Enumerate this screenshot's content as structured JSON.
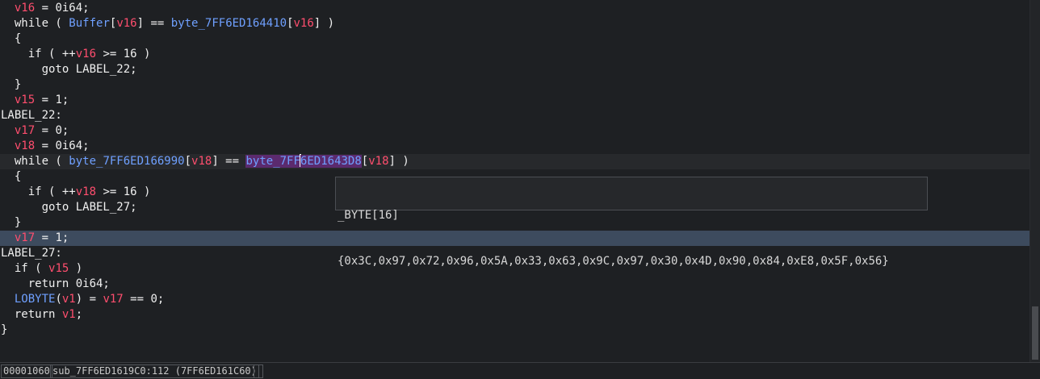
{
  "code": {
    "lines": [
      [
        [
          "  ",
          "pl"
        ],
        [
          "v16",
          "var"
        ],
        [
          " = 0i64;",
          "pl"
        ]
      ],
      [
        [
          "  while ( ",
          "kw"
        ],
        [
          "Buffer",
          "ident"
        ],
        [
          "[",
          "pl"
        ],
        [
          "v16",
          "var"
        ],
        [
          "] == ",
          "pl"
        ],
        [
          "byte_7FF6ED164410",
          "ident"
        ],
        [
          "[",
          "pl"
        ],
        [
          "v16",
          "var"
        ],
        [
          "] )",
          "pl"
        ]
      ],
      [
        [
          "  {",
          "pl"
        ]
      ],
      [
        [
          "    if ( ++",
          "kw"
        ],
        [
          "v16",
          "var"
        ],
        [
          " >= 16 )",
          "pl"
        ]
      ],
      [
        [
          "      goto LABEL_22;",
          "kw"
        ]
      ],
      [
        [
          "  }",
          "pl"
        ]
      ],
      [
        [
          "  ",
          "pl"
        ],
        [
          "v15",
          "var"
        ],
        [
          " = 1;",
          "pl"
        ]
      ],
      [
        [
          "LABEL_22:",
          "kw"
        ]
      ],
      [
        [
          "  ",
          "pl"
        ],
        [
          "v17",
          "var"
        ],
        [
          " = 0;",
          "pl"
        ]
      ],
      [
        [
          "  ",
          "pl"
        ],
        [
          "v18",
          "var"
        ],
        [
          " = 0i64;",
          "pl"
        ]
      ],
      [
        [
          "  while ( ",
          "kw"
        ],
        [
          "byte_7FF6ED166990",
          "ident"
        ],
        [
          "[",
          "pl"
        ],
        [
          "v18",
          "var"
        ],
        [
          "] == ",
          "pl"
        ],
        [
          "byte_7FF",
          "ident hl"
        ],
        [
          "|",
          "caret"
        ],
        [
          "6ED1643D8",
          "ident hl"
        ],
        [
          "[",
          "pl"
        ],
        [
          "v18",
          "var"
        ],
        [
          "] )",
          "pl"
        ]
      ],
      [
        [
          "  {",
          "pl"
        ]
      ],
      [
        [
          "    if ( ++",
          "kw"
        ],
        [
          "v18",
          "var"
        ],
        [
          " >= 16 )",
          "pl"
        ]
      ],
      [
        [
          "      goto LABEL_27;",
          "kw"
        ]
      ],
      [
        [
          "  }",
          "pl"
        ]
      ],
      [
        [
          "  ",
          "pl"
        ],
        [
          "v17",
          "var"
        ],
        [
          " = 1;",
          "pl"
        ]
      ],
      [
        [
          "LABEL_27:",
          "kw"
        ]
      ],
      [
        [
          "  if ( ",
          "kw"
        ],
        [
          "v15",
          "var"
        ],
        [
          " )",
          "pl"
        ]
      ],
      [
        [
          "    return 0i64;",
          "kw"
        ]
      ],
      [
        [
          "  ",
          "pl"
        ],
        [
          "LOBYTE",
          "ident"
        ],
        [
          "(",
          "pl"
        ],
        [
          "v1",
          "var"
        ],
        [
          ") = ",
          "pl"
        ],
        [
          "v17",
          "var"
        ],
        [
          " == 0;",
          "pl"
        ]
      ],
      [
        [
          "  return ",
          "kw"
        ],
        [
          "v1",
          "var"
        ],
        [
          ";",
          "pl"
        ]
      ],
      [
        [
          "}",
          "pl"
        ]
      ]
    ],
    "caret_line": 10,
    "selected_line": 15
  },
  "tooltip": {
    "type_line": "_BYTE[16]",
    "value_line": "{0x3C,0x97,0x72,0x96,0x5A,0x33,0x63,0x9C,0x97,0x30,0x4D,0x90,0x84,0xE8,0x5F,0x56}"
  },
  "statusbar": {
    "offset": "00001060",
    "location": "sub_7FF6ED1619C0:112 (7FF6ED161C60)",
    "extra": ""
  },
  "colors": {
    "background": "#1e2023",
    "variable": "#ff4e6e",
    "identifier": "#6fa0ff",
    "selection": "#3d4b5e",
    "highlight": "#5b2a6e"
  }
}
